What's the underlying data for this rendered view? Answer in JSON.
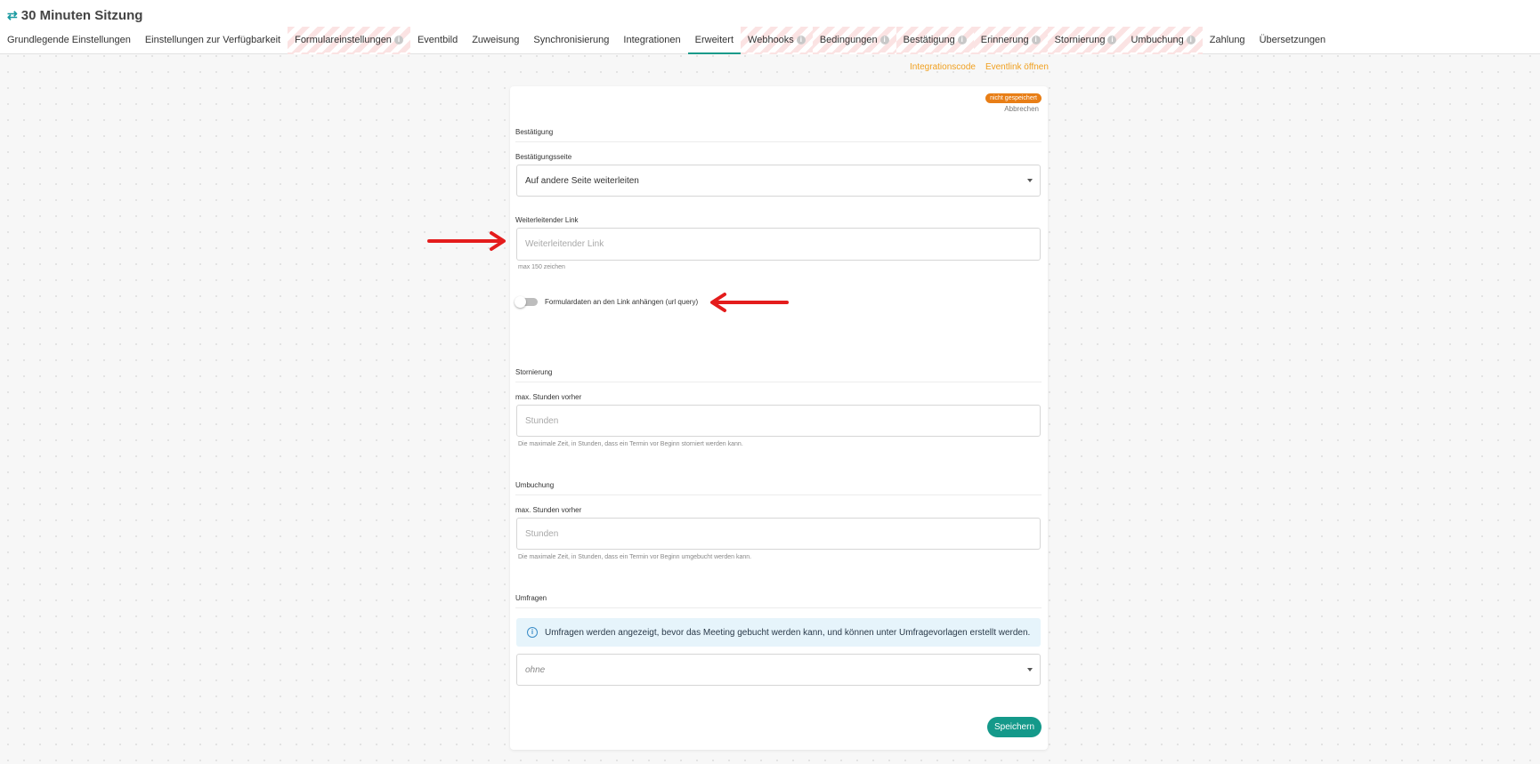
{
  "header": {
    "title_icon": "swap-arrows-icon",
    "title": "30 Minuten Sitzung"
  },
  "tabs": [
    {
      "label": "Grundlegende Einstellungen",
      "info": false,
      "striped": false,
      "active": false
    },
    {
      "label": "Einstellungen zur Verfügbarkeit",
      "info": false,
      "striped": false,
      "active": false
    },
    {
      "label": "Formulareinstellungen",
      "info": true,
      "striped": true,
      "active": false
    },
    {
      "label": "Eventbild",
      "info": false,
      "striped": false,
      "active": false
    },
    {
      "label": "Zuweisung",
      "info": false,
      "striped": false,
      "active": false
    },
    {
      "label": "Synchronisierung",
      "info": false,
      "striped": false,
      "active": false
    },
    {
      "label": "Integrationen",
      "info": false,
      "striped": false,
      "active": false
    },
    {
      "label": "Erweitert",
      "info": false,
      "striped": false,
      "active": true
    },
    {
      "label": "Webhooks",
      "info": true,
      "striped": true,
      "active": false
    },
    {
      "label": "Bedingungen",
      "info": true,
      "striped": true,
      "active": false
    },
    {
      "label": "Bestätigung",
      "info": true,
      "striped": true,
      "active": false
    },
    {
      "label": "Erinnerung",
      "info": true,
      "striped": true,
      "active": false
    },
    {
      "label": "Stornierung",
      "info": true,
      "striped": true,
      "active": false
    },
    {
      "label": "Umbuchung",
      "info": true,
      "striped": true,
      "active": false
    },
    {
      "label": "Zahlung",
      "info": false,
      "striped": false,
      "active": false
    },
    {
      "label": "Übersetzungen",
      "info": false,
      "striped": false,
      "active": false
    }
  ],
  "links": {
    "integration_code": "Integrationscode",
    "open_event_link": "Eventlink öffnen"
  },
  "card": {
    "badge": "nicht gespeichert",
    "cancel": "Abbrechen",
    "confirmation": {
      "section_title": "Bestätigung",
      "page_label": "Bestätigungsseite",
      "page_value": "Auf andere Seite weiterleiten",
      "link_label": "Weiterleitender Link",
      "link_value": "",
      "link_placeholder": "Weiterleitender Link",
      "link_hint": "max 150 zeichen",
      "toggle_label": "Formulardaten an den Link anhängen (url query)",
      "toggle_on": false
    },
    "cancellation": {
      "section_title": "Stornierung",
      "hours_label": "max. Stunden vorher",
      "hours_value": "",
      "hours_placeholder": "Stunden",
      "hint": "Die maximale Zeit, in Stunden, dass ein Termin vor Beginn storniert werden kann."
    },
    "rebooking": {
      "section_title": "Umbuchung",
      "hours_label": "max. Stunden vorher",
      "hours_value": "",
      "hours_placeholder": "Stunden",
      "hint": "Die maximale Zeit, in Stunden, dass ein Termin vor Beginn umgebucht werden kann."
    },
    "surveys": {
      "section_title": "Umfragen",
      "info": "Umfragen werden angezeigt, bevor das Meeting gebucht werden kann, und können unter Umfragevorlagen erstellt werden.",
      "select_value": "ohne"
    },
    "save": "Speichern"
  },
  "colors": {
    "accent": "#14998a",
    "link_orange": "#f0a020",
    "badge_orange": "#e87e16",
    "annotation_red": "#e41c1c"
  }
}
